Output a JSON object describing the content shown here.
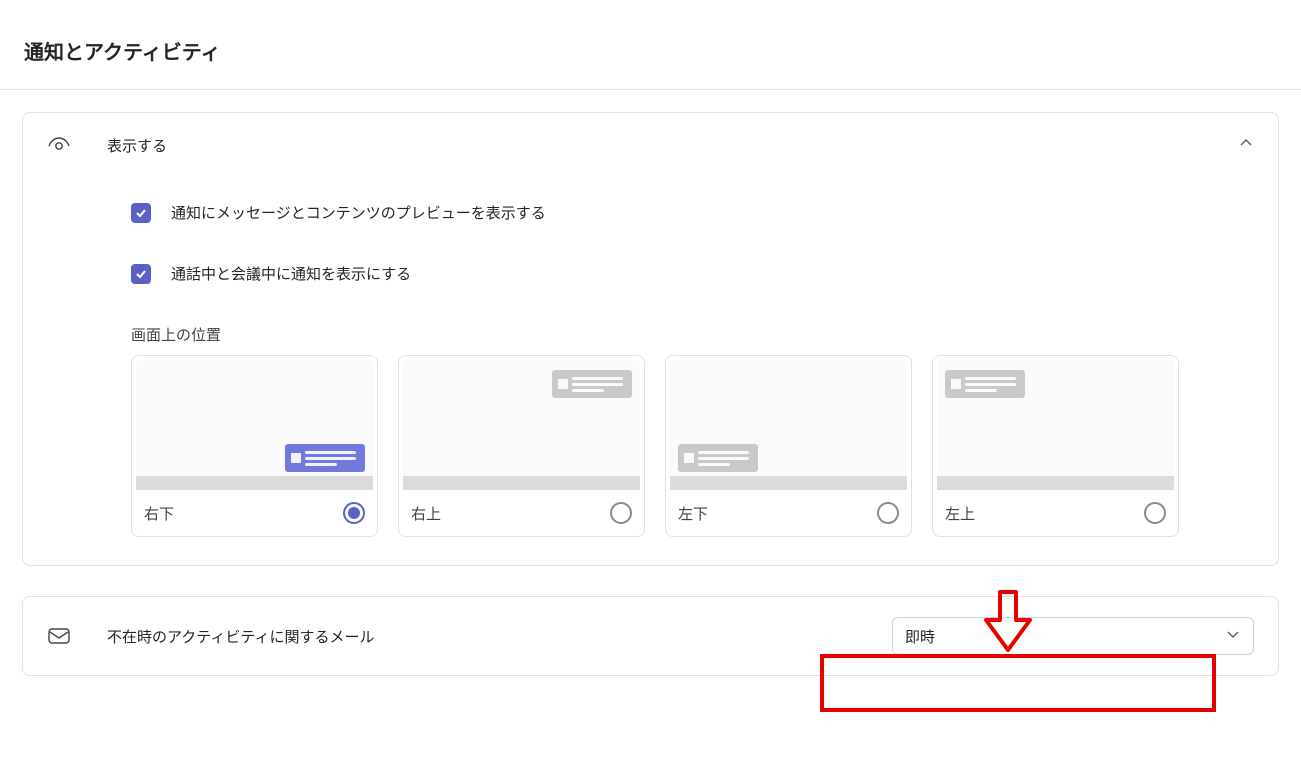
{
  "page": {
    "title": "通知とアクティビティ"
  },
  "display_section": {
    "title": "表示する",
    "checkbox_preview": "通知にメッセージとコンテンツのプレビューを表示する",
    "checkbox_during_call": "通話中と会議中に通知を表示にする",
    "position_label": "画面上の位置",
    "options": {
      "br": "右下",
      "tr": "右上",
      "bl": "左下",
      "tl": "左上"
    }
  },
  "email_section": {
    "title": "不在時のアクティビティに関するメール",
    "dropdown_value": "即時"
  }
}
